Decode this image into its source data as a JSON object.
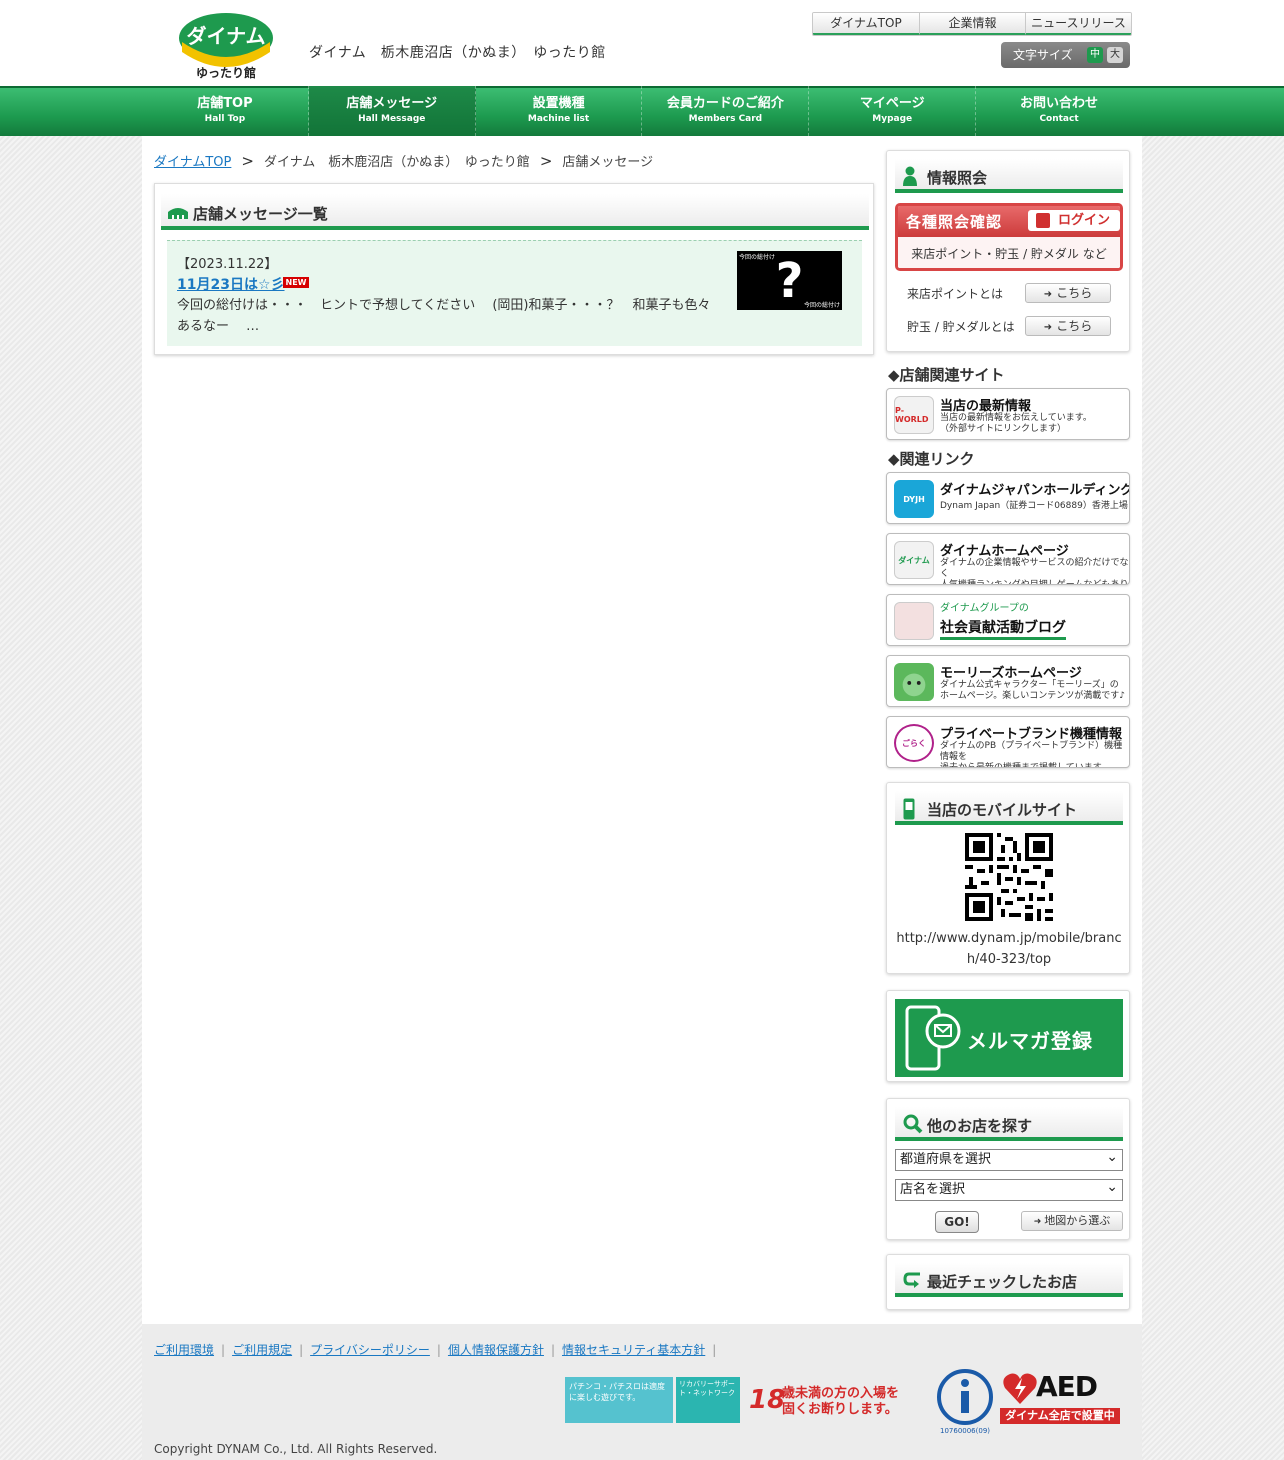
{
  "header": {
    "logo_text": "ダイナム",
    "logo_sub": "ゆったり館",
    "shop_title": "ダイナム　栃木鹿沼店（かぬま）　ゆったり館",
    "top_links": [
      "ダイナムTOP",
      "企業情報",
      "ニュースリリース"
    ],
    "font_size_label": "文字サイズ",
    "font_size_mid": "中",
    "font_size_big": "大"
  },
  "global_nav": [
    {
      "jp": "店舗TOP",
      "en": "Hall Top"
    },
    {
      "jp": "店舗メッセージ",
      "en": "Hall Message"
    },
    {
      "jp": "設置機種",
      "en": "Machine list"
    },
    {
      "jp": "会員カードのご紹介",
      "en": "Members Card"
    },
    {
      "jp": "マイページ",
      "en": "Mypage"
    },
    {
      "jp": "お問い合わせ",
      "en": "Contact"
    }
  ],
  "breadcrumb": {
    "home": "ダイナムTOP",
    "shop": "ダイナム　栃木鹿沼店（かぬま）　ゆったり館",
    "current": "店舗メッセージ",
    "separator": ">"
  },
  "message_list": {
    "title": "店舗メッセージ一覧",
    "items": [
      {
        "date": "【2023.11.22】",
        "title": "11月23日は☆彡",
        "new_badge": "NEW",
        "body": "今回の総付けは・・・　ヒントで予想してください　 (岡田)和菓子・・・？　和菓子も色々あるなー　 …",
        "thumb_mark": "?",
        "thumb_caption": "今回の総付け"
      }
    ]
  },
  "sidebar": {
    "info": {
      "title": "情報照会",
      "card_title": "各種照会確認",
      "login": "ログイン",
      "card_sub": "来店ポイント・貯玉 / 貯メダル など",
      "rows": [
        {
          "label": "来店ポイントとは",
          "button": "こちら"
        },
        {
          "label": "貯玉 / 貯メダルとは",
          "button": "こちら"
        }
      ]
    },
    "related_sites_head": "◆店舗関連サイト",
    "pworld": {
      "icon": "P-WORLD",
      "title": "当店の最新情報",
      "desc": "当店の最新情報をお伝えしています。\n（外部サイトにリンクします）"
    },
    "related_links_head": "◆関連リンク",
    "links": [
      {
        "icon": "DYJH",
        "title": "ダイナムジャパンホールディングス",
        "desc": "Dynam Japan（証券コード06889）香港上場"
      },
      {
        "icon": "ダイナム",
        "title": "ダイナムホームページ",
        "desc": "ダイナムの企業情報やサービスの紹介だけでなく\n人気機種ランキングや目押しゲームなどもあります。"
      },
      {
        "icon": "",
        "title": "社会貢献活動ブログ",
        "desc": "ダイナムグループの"
      },
      {
        "icon": "",
        "title": "モーリーズホームページ",
        "desc": "ダイナム公式キャラクター「モーリーズ」の\nホームページ。楽しいコンテンツが満載です♪"
      },
      {
        "icon": "ごらく",
        "title": "プライベートブランド機種情報",
        "desc": "ダイナムのPB（プライベートブランド）機種 情報を\n過去から最新の機種まで掲載しています。"
      }
    ],
    "mobile": {
      "title": "当店のモバイルサイト",
      "url": "http://www.dynam.jp/mobile/branch/40-323/top"
    },
    "mailmag": {
      "label": "メルマガ登録"
    },
    "search": {
      "title": "他のお店を探す",
      "prefecture_select": "都道府県を選択",
      "shop_select": "店名を選択",
      "go": "GO!",
      "map": "地図から選ぶ"
    },
    "recent": {
      "title": "最近チェックしたお店"
    }
  },
  "footer": {
    "links": [
      "ご利用環境",
      "ご利用規定",
      "プライバシーポリシー",
      "個人情報保護方針",
      "情報セキュリティ基本方針"
    ],
    "banner1": "パチンコ・パチスロは適度に楽しむ遊びです。",
    "banner2": "リカバリーサポート・ネットワーク",
    "age_num": "18",
    "age_text": "歳未満の方の入場を\n固くお断りします。",
    "privacy_code": "10760006(09)",
    "aed": "AED",
    "aed_sub": "ダイナム全店で設置中",
    "copyright": "Copyright DYNAM Co., Ltd. All Rights Reserved."
  },
  "colors": {
    "brand_green": "#1e9a4e",
    "link_blue": "#1a78c2",
    "login_red": "#d84545",
    "new_red": "#d60000"
  }
}
